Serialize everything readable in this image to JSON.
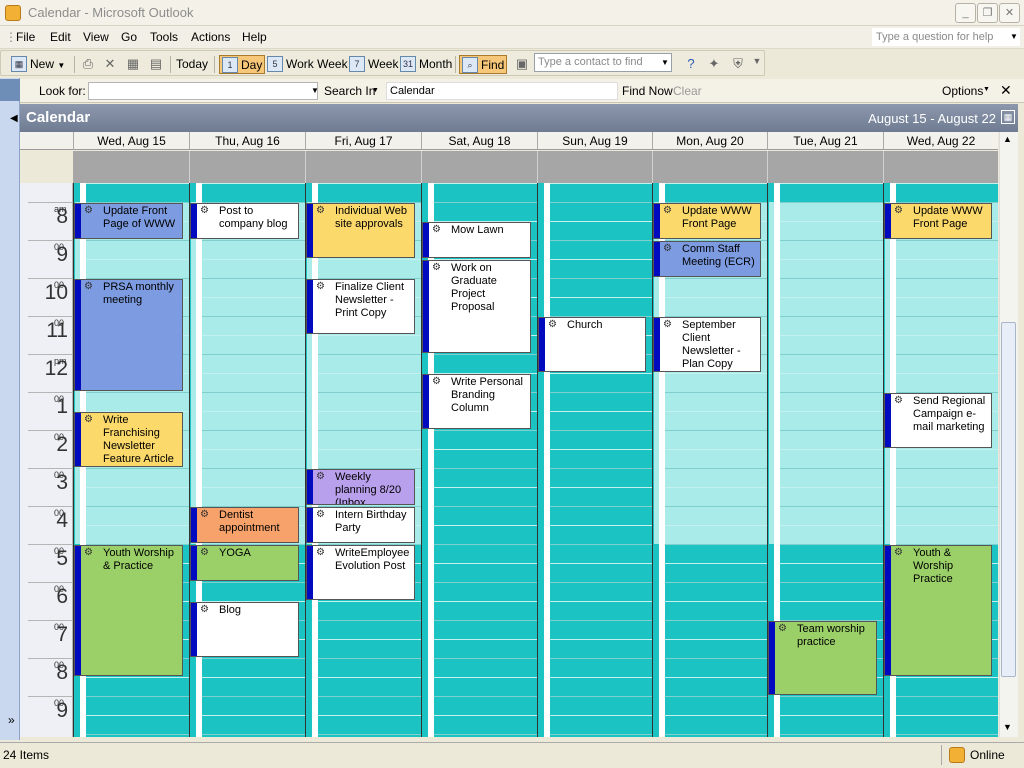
{
  "window": {
    "title": "Calendar - Microsoft Outlook"
  },
  "menu": {
    "items": [
      "File",
      "Edit",
      "View",
      "Go",
      "Tools",
      "Actions",
      "Help"
    ],
    "ask_placeholder": "Type a question for help"
  },
  "toolbar": {
    "new_label": "New",
    "today_label": "Today",
    "day_label": "Day",
    "workweek_label": "Work Week",
    "week_label": "Week",
    "month_label": "Month",
    "find_label": "Find",
    "contact_placeholder": "Type a contact to find"
  },
  "findbar": {
    "look_for_label": "Look for:",
    "search_in_label": "Search In",
    "search_in_value": "Calendar",
    "find_now_label": "Find Now",
    "clear_label": "Clear",
    "options_label": "Options"
  },
  "calendar": {
    "title": "Calendar",
    "range": "August 15 - August 22"
  },
  "days": [
    "Wed, Aug 15",
    "Thu, Aug 16",
    "Fri, Aug 17",
    "Sat, Aug 18",
    "Sun, Aug 19",
    "Mon, Aug 20",
    "Tue, Aug 21",
    "Wed, Aug 22"
  ],
  "hours": [
    {
      "h": "8",
      "s": "am"
    },
    {
      "h": "9",
      "s": "00"
    },
    {
      "h": "10",
      "s": "00"
    },
    {
      "h": "11",
      "s": "00"
    },
    {
      "h": "12",
      "s": "pm"
    },
    {
      "h": "1",
      "s": "00"
    },
    {
      "h": "2",
      "s": "00"
    },
    {
      "h": "3",
      "s": "00"
    },
    {
      "h": "4",
      "s": "00"
    },
    {
      "h": "5",
      "s": "00"
    },
    {
      "h": "6",
      "s": "00"
    },
    {
      "h": "7",
      "s": "00"
    },
    {
      "h": "8",
      "s": "00"
    },
    {
      "h": "9",
      "s": "00"
    }
  ],
  "events": [
    {
      "day": 0,
      "start": 8,
      "end": 9,
      "text": "Update Front Page of WWW",
      "color": "#7d9be0"
    },
    {
      "day": 0,
      "start": 10,
      "end": 13,
      "text": "PRSA monthly meeting",
      "color": "#7d9be0"
    },
    {
      "day": 0,
      "start": 13.5,
      "end": 15,
      "text": "Write Franchising Newsletter Feature Article",
      "color": "#fcd96b"
    },
    {
      "day": 0,
      "start": 17,
      "end": 20.5,
      "text": "Youth Worship & Practice",
      "color": "#9bd069"
    },
    {
      "day": 1,
      "start": 8,
      "end": 9,
      "text": "Post to company blog",
      "color": "#ffffff"
    },
    {
      "day": 1,
      "start": 16,
      "end": 17,
      "text": "Dentist appointment",
      "color": "#f6a26a"
    },
    {
      "day": 1,
      "start": 17,
      "end": 18,
      "text": "YOGA",
      "color": "#9bd069"
    },
    {
      "day": 1,
      "start": 18.5,
      "end": 20,
      "text": "Blog",
      "color": "#ffffff"
    },
    {
      "day": 2,
      "start": 8,
      "end": 9.5,
      "text": "Individual Web site approvals",
      "color": "#fcd96b"
    },
    {
      "day": 2,
      "start": 10,
      "end": 11.5,
      "text": "Finalize Client Newsletter - Print Copy",
      "color": "#ffffff"
    },
    {
      "day": 2,
      "start": 15,
      "end": 16,
      "text": "Weekly planning 8/20 (Inbox",
      "color": "#b9a0ec"
    },
    {
      "day": 2,
      "start": 16,
      "end": 17,
      "text": "Intern Birthday Party",
      "color": "#ffffff"
    },
    {
      "day": 2,
      "start": 17,
      "end": 18.5,
      "text": "WriteEmployee Evolution Post",
      "color": "#ffffff"
    },
    {
      "day": 3,
      "start": 8.5,
      "end": 9.5,
      "text": "Mow Lawn",
      "color": "#ffffff"
    },
    {
      "day": 3,
      "start": 9.5,
      "end": 12,
      "text": "Work on Graduate Project Proposal",
      "color": "#ffffff"
    },
    {
      "day": 3,
      "start": 12.5,
      "end": 14,
      "text": "Write Personal Branding Column",
      "color": "#ffffff"
    },
    {
      "day": 4,
      "start": 11,
      "end": 12.5,
      "text": "Church",
      "color": "#ffffff"
    },
    {
      "day": 5,
      "start": 8,
      "end": 9,
      "text": "Update WWW Front Page",
      "color": "#fcd96b"
    },
    {
      "day": 5,
      "start": 9,
      "end": 10,
      "text": "Comm Staff Meeting (ECR)",
      "color": "#7d9be0"
    },
    {
      "day": 5,
      "start": 11,
      "end": 12.5,
      "text": "September Client Newsletter - Plan Copy",
      "color": "#ffffff"
    },
    {
      "day": 6,
      "start": 19,
      "end": 21,
      "text": "Team worship practice",
      "color": "#9bd069"
    },
    {
      "day": 7,
      "start": 8,
      "end": 9,
      "text": "Update WWW Front Page",
      "color": "#fcd96b"
    },
    {
      "day": 7,
      "start": 13,
      "end": 14.5,
      "text": "Send Regional Campaign e-mail marketing",
      "color": "#ffffff"
    },
    {
      "day": 7,
      "start": 17,
      "end": 20.5,
      "text": "Youth & Worship Practice",
      "color": "#9bd069"
    }
  ],
  "status": {
    "items_text": "24 Items",
    "online_text": "Online"
  },
  "colors": {
    "work_hours": "#a8ebe8",
    "off_hours": "#1bc3c3",
    "appointment_bar": "#000abf"
  }
}
